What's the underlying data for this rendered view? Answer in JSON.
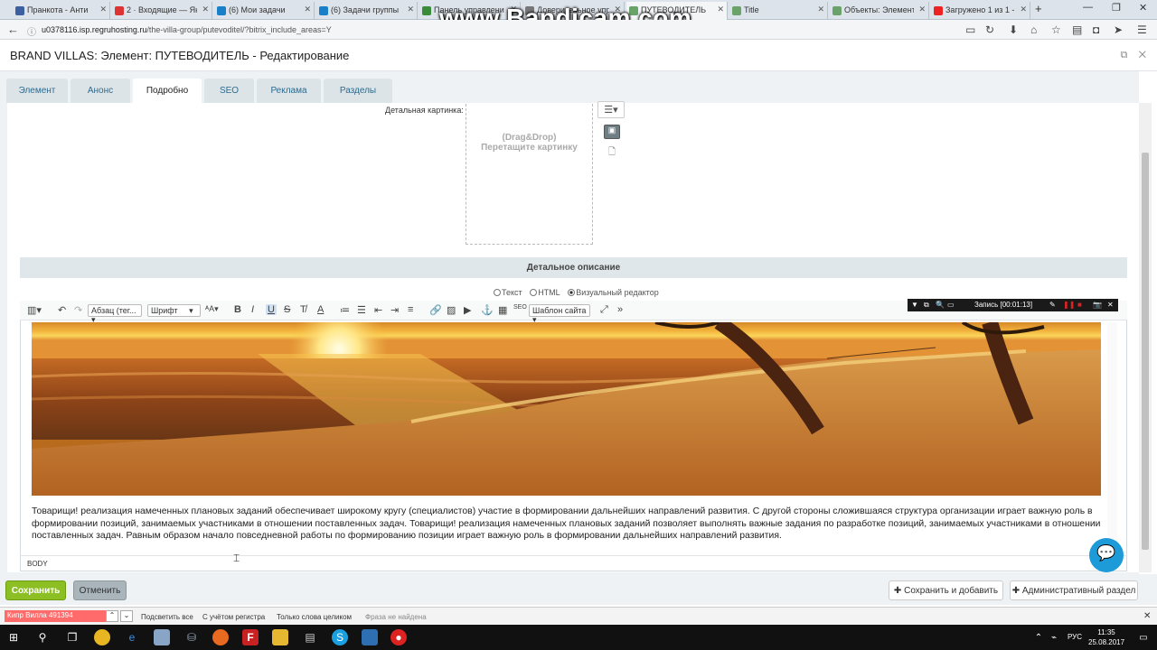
{
  "browser": {
    "tabs": [
      {
        "label": "Пранкота - Анти",
        "color": "#3b5fa0"
      },
      {
        "label": "2 · Входящие — Янд",
        "color": "#d33"
      },
      {
        "label": "(6) Мои задачи",
        "color": "#1a7fc9"
      },
      {
        "label": "(6) Задачи группы",
        "color": "#1a7fc9"
      },
      {
        "label": "Панель управлени",
        "color": "#3a8c3a"
      },
      {
        "label": "Доверительное управ",
        "color": "#777"
      },
      {
        "label": "ПУТЕВОДИТЕЛЬ",
        "color": "#6aa36a"
      },
      {
        "label": "Title",
        "color": "#6aa36a"
      },
      {
        "label": "Объекты: Элемент:",
        "color": "#6aa36a"
      },
      {
        "label": "Загружено 1 из 1 - Y",
        "color": "#e22"
      }
    ],
    "url_host": "u0378116.isp.regruhosting.ru",
    "url_path": "/the-villa-group/putevoditel/?bitrix_include_areas=Y"
  },
  "watermark": "www.Bandicam.com",
  "page": {
    "title": "BRAND VILLAS: Элемент: ПУТЕВОДИТЕЛЬ - Редактирование"
  },
  "element_tabs": [
    "Элемент",
    "Анонс",
    "Подробно",
    "SEO",
    "Реклама",
    "Разделы"
  ],
  "detail_picture": {
    "label": "Детальная картинка:",
    "drop_line1": "(Drag&Drop)",
    "drop_line2": "Перетащите картинку"
  },
  "detail_description": {
    "header": "Детальное описание",
    "modes": [
      "Текст",
      "HTML",
      "Визуальный редактор"
    ],
    "selected_mode": "Визуальный редактор"
  },
  "toolbar": {
    "paragraph": "Абзац (тег...",
    "font": "Шрифт",
    "template": "Шаблон сайта"
  },
  "recorder": {
    "label": "Запись [00:01:13]"
  },
  "editor": {
    "body_text": "Товарищи! реализация намеченных плановых заданий обеспечивает широкому кругу (специалистов) участие в формировании дальнейших направлений развития. С другой стороны сложившаяся структура организации играет важную роль в формировании позиций, занимаемых участниками в отношении поставленных задач. Товарищи! реализация намеченных плановых заданий позволяет выполнять важные задания по разработке позиций, занимаемых участниками в отношении поставленных задач. Равным образом начало повседневной работы по формированию позиции играет важную роль в формировании дальнейших направлений развития.",
    "status_tag": "BODY"
  },
  "footer": {
    "save": "Сохранить",
    "cancel": "Отменить",
    "save_add": "Сохранить и добавить",
    "admin_section": "Административный раздел"
  },
  "findbar": {
    "query": "Кипр Вилла 491394",
    "highlight_all": "Подсветить все",
    "match_case": "С учётом регистра",
    "whole_words": "Только слова целиком",
    "status": "Фраза не найдена"
  },
  "taskbar": {
    "lang": "РУС",
    "time": "11:35",
    "date": "25.08.2017"
  }
}
